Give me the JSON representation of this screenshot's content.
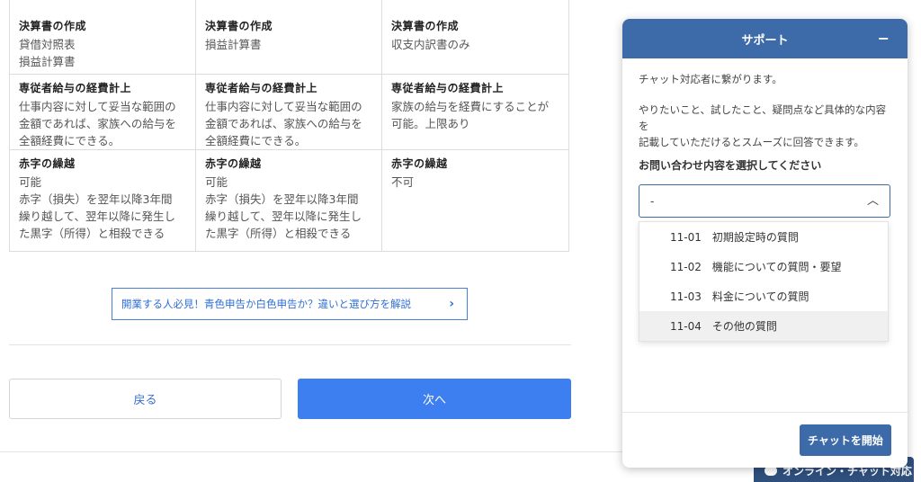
{
  "grid": {
    "rows": [
      [
        {
          "heading": "決算書の作成",
          "text": "貸借対照表\n損益計算書"
        },
        {
          "heading": "決算書の作成",
          "text": "損益計算書"
        },
        {
          "heading": "決算書の作成",
          "text": "収支内訳書のみ"
        }
      ],
      [
        {
          "heading": "専従者給与の経費計上",
          "text": "仕事内容に対して妥当な範囲の\n金額であれば、家族への給与を\n全額経費にできる。"
        },
        {
          "heading": "専従者給与の経費計上",
          "text": "仕事内容に対して妥当な範囲の\n金額であれば、家族への給与を\n全額経費にできる。"
        },
        {
          "heading": "専従者給与の経費計上",
          "text": "家族の給与を経費にすることが\n可能。上限あり"
        }
      ],
      [
        {
          "heading": "赤字の繰越",
          "text": "可能\n赤字（損失）を翌年以降3年間\n繰り越して、翌年以降に発生し\nた黒字（所得）と相殺できる"
        },
        {
          "heading": "赤字の繰越",
          "text": "可能\n赤字（損失）を翌年以降3年間\n繰り越して、翌年以降に発生し\nた黒字（所得）と相殺できる"
        },
        {
          "heading": "赤字の繰越",
          "text": "不可"
        }
      ]
    ]
  },
  "article_link": {
    "label": "開業する人必見！青色申告か白色申告か？違いと選び方を解説",
    "icon": "chevron-right-icon"
  },
  "nav": {
    "back_label": "戻る",
    "next_label": "次へ"
  },
  "chat_badge": {
    "label": "オンライン・チャット対応"
  },
  "support": {
    "title": "サポート",
    "minimize": "−",
    "intro": "チャット対応者に繋がります。",
    "instructions": "やりたいこと、試したこと、疑問点など具体的な内容を\n記載していただけるとスムーズに回答できます。",
    "select_label": "お問い合わせ内容を選択してください",
    "select_value": "-",
    "options": [
      {
        "code": "11-01",
        "label": "初期設定時の質問"
      },
      {
        "code": "11-02",
        "label": "機能についての質問・要望"
      },
      {
        "code": "11-03",
        "label": "料金についての質問"
      },
      {
        "code": "11-04",
        "label": "その他の質問"
      }
    ],
    "start_label": "チャットを開始"
  },
  "colors": {
    "accent": "#3d7ef0",
    "panel_header": "#3d6aa8",
    "link": "#2f6fd6"
  }
}
